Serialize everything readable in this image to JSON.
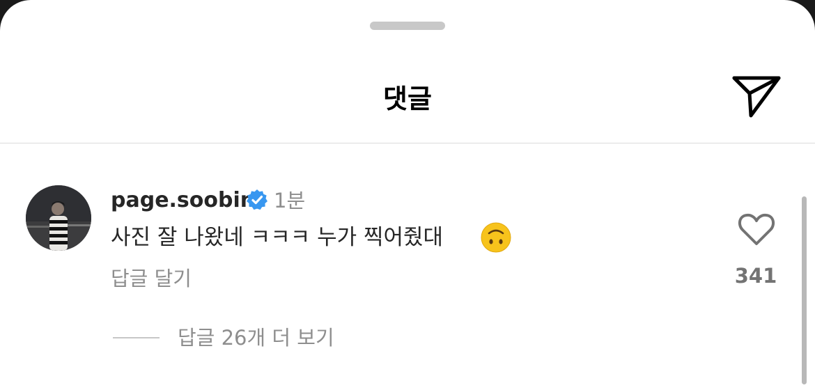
{
  "header": {
    "title": "댓글"
  },
  "comment": {
    "username": "page.soobin",
    "time": "1분",
    "text": "사진 잘 나왔네 ㅋㅋㅋ 누가 찍어줬대",
    "reply_label": "답글 달기",
    "like_count": "341",
    "view_replies_label": "답글 26개 더 보기"
  },
  "colors": {
    "verified_blue": "#3897f0",
    "emoji_yellow": "#f7c31c"
  },
  "icons": {
    "share": "paper-plane-icon",
    "like": "heart-outline-icon",
    "verified": "verified-badge-icon",
    "emoji": "upside-down-face-emoji"
  }
}
